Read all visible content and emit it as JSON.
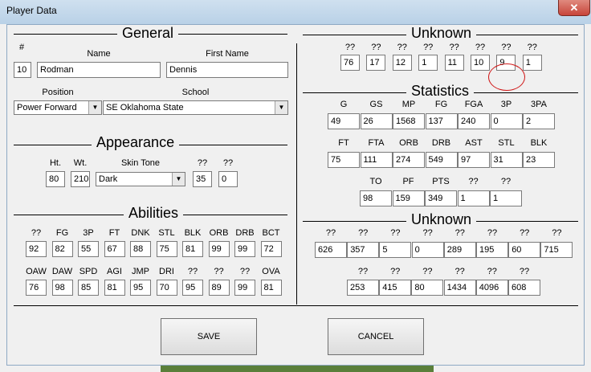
{
  "window": {
    "title": "Player Data",
    "close_glyph": "✕"
  },
  "sections": {
    "general": "General",
    "appearance": "Appearance",
    "abilities": "Abilities",
    "unknown1": "Unknown",
    "statistics": "Statistics",
    "unknown2": "Unknown"
  },
  "general": {
    "num_label": "#",
    "num": "10",
    "name_label": "Name",
    "name": "Rodman",
    "first_label": "First Name",
    "first": "Dennis",
    "position_label": "Position",
    "position": "Power Forward",
    "school_label": "School",
    "school": "SE Oklahoma State"
  },
  "appearance": {
    "ht_label": "Ht.",
    "ht": "80",
    "wt_label": "Wt.",
    "wt": "210",
    "skin_label": "Skin Tone",
    "skin": "Dark",
    "u1_label": "??",
    "u1": "35",
    "u2_label": "??",
    "u2": "0"
  },
  "abilities": {
    "row1_labels": [
      "??",
      "FG",
      "3P",
      "FT",
      "DNK",
      "STL",
      "BLK",
      "ORB",
      "DRB",
      "BCT"
    ],
    "row1_values": [
      "92",
      "82",
      "55",
      "67",
      "88",
      "75",
      "81",
      "99",
      "99",
      "72"
    ],
    "row2_labels": [
      "OAW",
      "DAW",
      "SPD",
      "AGI",
      "JMP",
      "DRI",
      "??",
      "??",
      "??",
      "OVA"
    ],
    "row2_values": [
      "76",
      "98",
      "85",
      "81",
      "95",
      "70",
      "95",
      "89",
      "99",
      "81"
    ]
  },
  "unknown1": {
    "labels": [
      "??",
      "??",
      "??",
      "??",
      "??",
      "??",
      "??",
      "??"
    ],
    "values": [
      "76",
      "17",
      "12",
      "1",
      "11",
      "10",
      "9",
      "1"
    ]
  },
  "statistics": {
    "row1_labels": [
      "G",
      "GS",
      "MP",
      "FG",
      "FGA",
      "3P",
      "3PA"
    ],
    "row1_values": [
      "49",
      "26",
      "1568",
      "137",
      "240",
      "0",
      "2"
    ],
    "row2_labels": [
      "FT",
      "FTA",
      "ORB",
      "DRB",
      "AST",
      "STL",
      "BLK"
    ],
    "row2_values": [
      "75",
      "111",
      "274",
      "549",
      "97",
      "31",
      "23"
    ],
    "row3_labels": [
      "TO",
      "PF",
      "PTS",
      "??",
      "??"
    ],
    "row3_values": [
      "98",
      "159",
      "349",
      "1",
      "1"
    ]
  },
  "unknown2": {
    "row1_labels": [
      "??",
      "??",
      "??",
      "??",
      "??",
      "??",
      "??",
      "??"
    ],
    "row1_values": [
      "626",
      "357",
      "5",
      "0",
      "289",
      "195",
      "60",
      "715"
    ],
    "row2_labels": [
      "??",
      "??",
      "??",
      "??",
      "??",
      "??"
    ],
    "row2_values": [
      "253",
      "415",
      "80",
      "1434",
      "4096",
      "608"
    ]
  },
  "buttons": {
    "save": "SAVE",
    "cancel": "CANCEL"
  },
  "colors": {
    "highlight_circle": "#d01818",
    "window_frame": "#b9d1e7"
  }
}
